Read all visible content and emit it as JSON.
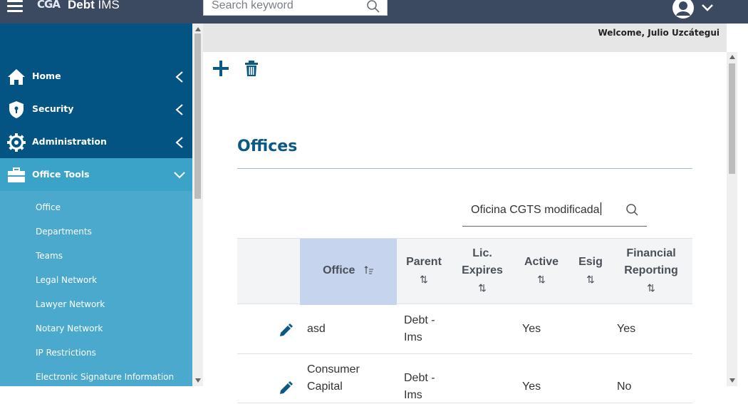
{
  "app": {
    "logo": "CGA",
    "name_bold": "Debt",
    "name_rest": " IMS"
  },
  "header": {
    "search_placeholder": "Search keyword",
    "welcome": "Welcome, Julio Uzcátegui"
  },
  "sidebar": {
    "items": [
      {
        "label": "Home",
        "icon": "home-icon"
      },
      {
        "label": "Security",
        "icon": "shield-icon"
      },
      {
        "label": "Administration",
        "icon": "gear-icon"
      },
      {
        "label": "Office Tools",
        "icon": "briefcase-icon"
      }
    ],
    "submenu": [
      "Office",
      "Departments",
      "Teams",
      "Legal Network",
      "Lawyer Network",
      "Notary Network",
      "IP Restrictions",
      "Electronic Signature Information"
    ]
  },
  "page": {
    "title": "Offices",
    "search_value": "Oficina CGTS modificada"
  },
  "table": {
    "columns": {
      "office": "Office",
      "parent": "Parent",
      "lic_expires_1": "Lic.",
      "lic_expires_2": "Expires",
      "active": "Active",
      "esig": "Esig",
      "financial_1": "Financial",
      "financial_2": "Reporting"
    },
    "sort_icon": "⇅",
    "rows": [
      {
        "office_1": "asd",
        "office_2": "",
        "parent_1": "Debt -",
        "parent_2": "Ims",
        "active": "Yes",
        "financial": "Yes"
      },
      {
        "office_1": "Consumer",
        "office_2": "Capital",
        "parent_1": "Debt -",
        "parent_2": "Ims",
        "active": "Yes",
        "financial": "No"
      }
    ]
  },
  "colors": {
    "topbar": "#3b4a61",
    "sidebar": "#035482",
    "sidebar_active": "#3aa3c7",
    "submenu": "#4aa9cd",
    "title": "#0a5a85",
    "sorted_header": "#c6d4ee"
  }
}
